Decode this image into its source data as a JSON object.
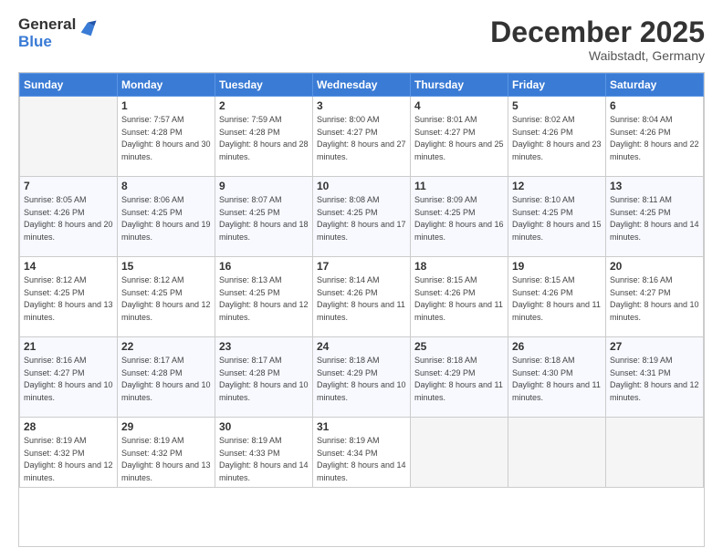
{
  "logo": {
    "general": "General",
    "blue": "Blue"
  },
  "title": "December 2025",
  "location": "Waibstadt, Germany",
  "days_of_week": [
    "Sunday",
    "Monday",
    "Tuesday",
    "Wednesday",
    "Thursday",
    "Friday",
    "Saturday"
  ],
  "weeks": [
    [
      {
        "day": "",
        "sunrise": "",
        "sunset": "",
        "daylight": ""
      },
      {
        "day": "1",
        "sunrise": "Sunrise: 7:57 AM",
        "sunset": "Sunset: 4:28 PM",
        "daylight": "Daylight: 8 hours and 30 minutes."
      },
      {
        "day": "2",
        "sunrise": "Sunrise: 7:59 AM",
        "sunset": "Sunset: 4:28 PM",
        "daylight": "Daylight: 8 hours and 28 minutes."
      },
      {
        "day": "3",
        "sunrise": "Sunrise: 8:00 AM",
        "sunset": "Sunset: 4:27 PM",
        "daylight": "Daylight: 8 hours and 27 minutes."
      },
      {
        "day": "4",
        "sunrise": "Sunrise: 8:01 AM",
        "sunset": "Sunset: 4:27 PM",
        "daylight": "Daylight: 8 hours and 25 minutes."
      },
      {
        "day": "5",
        "sunrise": "Sunrise: 8:02 AM",
        "sunset": "Sunset: 4:26 PM",
        "daylight": "Daylight: 8 hours and 23 minutes."
      },
      {
        "day": "6",
        "sunrise": "Sunrise: 8:04 AM",
        "sunset": "Sunset: 4:26 PM",
        "daylight": "Daylight: 8 hours and 22 minutes."
      }
    ],
    [
      {
        "day": "7",
        "sunrise": "Sunrise: 8:05 AM",
        "sunset": "Sunset: 4:26 PM",
        "daylight": "Daylight: 8 hours and 20 minutes."
      },
      {
        "day": "8",
        "sunrise": "Sunrise: 8:06 AM",
        "sunset": "Sunset: 4:25 PM",
        "daylight": "Daylight: 8 hours and 19 minutes."
      },
      {
        "day": "9",
        "sunrise": "Sunrise: 8:07 AM",
        "sunset": "Sunset: 4:25 PM",
        "daylight": "Daylight: 8 hours and 18 minutes."
      },
      {
        "day": "10",
        "sunrise": "Sunrise: 8:08 AM",
        "sunset": "Sunset: 4:25 PM",
        "daylight": "Daylight: 8 hours and 17 minutes."
      },
      {
        "day": "11",
        "sunrise": "Sunrise: 8:09 AM",
        "sunset": "Sunset: 4:25 PM",
        "daylight": "Daylight: 8 hours and 16 minutes."
      },
      {
        "day": "12",
        "sunrise": "Sunrise: 8:10 AM",
        "sunset": "Sunset: 4:25 PM",
        "daylight": "Daylight: 8 hours and 15 minutes."
      },
      {
        "day": "13",
        "sunrise": "Sunrise: 8:11 AM",
        "sunset": "Sunset: 4:25 PM",
        "daylight": "Daylight: 8 hours and 14 minutes."
      }
    ],
    [
      {
        "day": "14",
        "sunrise": "Sunrise: 8:12 AM",
        "sunset": "Sunset: 4:25 PM",
        "daylight": "Daylight: 8 hours and 13 minutes."
      },
      {
        "day": "15",
        "sunrise": "Sunrise: 8:12 AM",
        "sunset": "Sunset: 4:25 PM",
        "daylight": "Daylight: 8 hours and 12 minutes."
      },
      {
        "day": "16",
        "sunrise": "Sunrise: 8:13 AM",
        "sunset": "Sunset: 4:25 PM",
        "daylight": "Daylight: 8 hours and 12 minutes."
      },
      {
        "day": "17",
        "sunrise": "Sunrise: 8:14 AM",
        "sunset": "Sunset: 4:26 PM",
        "daylight": "Daylight: 8 hours and 11 minutes."
      },
      {
        "day": "18",
        "sunrise": "Sunrise: 8:15 AM",
        "sunset": "Sunset: 4:26 PM",
        "daylight": "Daylight: 8 hours and 11 minutes."
      },
      {
        "day": "19",
        "sunrise": "Sunrise: 8:15 AM",
        "sunset": "Sunset: 4:26 PM",
        "daylight": "Daylight: 8 hours and 11 minutes."
      },
      {
        "day": "20",
        "sunrise": "Sunrise: 8:16 AM",
        "sunset": "Sunset: 4:27 PM",
        "daylight": "Daylight: 8 hours and 10 minutes."
      }
    ],
    [
      {
        "day": "21",
        "sunrise": "Sunrise: 8:16 AM",
        "sunset": "Sunset: 4:27 PM",
        "daylight": "Daylight: 8 hours and 10 minutes."
      },
      {
        "day": "22",
        "sunrise": "Sunrise: 8:17 AM",
        "sunset": "Sunset: 4:28 PM",
        "daylight": "Daylight: 8 hours and 10 minutes."
      },
      {
        "day": "23",
        "sunrise": "Sunrise: 8:17 AM",
        "sunset": "Sunset: 4:28 PM",
        "daylight": "Daylight: 8 hours and 10 minutes."
      },
      {
        "day": "24",
        "sunrise": "Sunrise: 8:18 AM",
        "sunset": "Sunset: 4:29 PM",
        "daylight": "Daylight: 8 hours and 10 minutes."
      },
      {
        "day": "25",
        "sunrise": "Sunrise: 8:18 AM",
        "sunset": "Sunset: 4:29 PM",
        "daylight": "Daylight: 8 hours and 11 minutes."
      },
      {
        "day": "26",
        "sunrise": "Sunrise: 8:18 AM",
        "sunset": "Sunset: 4:30 PM",
        "daylight": "Daylight: 8 hours and 11 minutes."
      },
      {
        "day": "27",
        "sunrise": "Sunrise: 8:19 AM",
        "sunset": "Sunset: 4:31 PM",
        "daylight": "Daylight: 8 hours and 12 minutes."
      }
    ],
    [
      {
        "day": "28",
        "sunrise": "Sunrise: 8:19 AM",
        "sunset": "Sunset: 4:32 PM",
        "daylight": "Daylight: 8 hours and 12 minutes."
      },
      {
        "day": "29",
        "sunrise": "Sunrise: 8:19 AM",
        "sunset": "Sunset: 4:32 PM",
        "daylight": "Daylight: 8 hours and 13 minutes."
      },
      {
        "day": "30",
        "sunrise": "Sunrise: 8:19 AM",
        "sunset": "Sunset: 4:33 PM",
        "daylight": "Daylight: 8 hours and 14 minutes."
      },
      {
        "day": "31",
        "sunrise": "Sunrise: 8:19 AM",
        "sunset": "Sunset: 4:34 PM",
        "daylight": "Daylight: 8 hours and 14 minutes."
      },
      {
        "day": "",
        "sunrise": "",
        "sunset": "",
        "daylight": ""
      },
      {
        "day": "",
        "sunrise": "",
        "sunset": "",
        "daylight": ""
      },
      {
        "day": "",
        "sunrise": "",
        "sunset": "",
        "daylight": ""
      }
    ]
  ]
}
